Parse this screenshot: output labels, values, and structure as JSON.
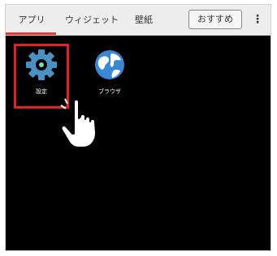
{
  "tabs": {
    "apps": "アプリ",
    "widgets": "ウィジェット",
    "wallpaper": "壁紙",
    "recommend": "おすすめ",
    "more": "⋮"
  },
  "apps": [
    {
      "label": "設定",
      "icon": "settings-gear-icon"
    },
    {
      "label": "ブラウザ",
      "icon": "globe-browser-icon"
    }
  ],
  "colors": {
    "accent": "#e53935",
    "highlight": "#e02424",
    "background": "#000000",
    "tabbar": "#ededed",
    "gear": "#4a90c2",
    "globe": "#3b87d4"
  }
}
